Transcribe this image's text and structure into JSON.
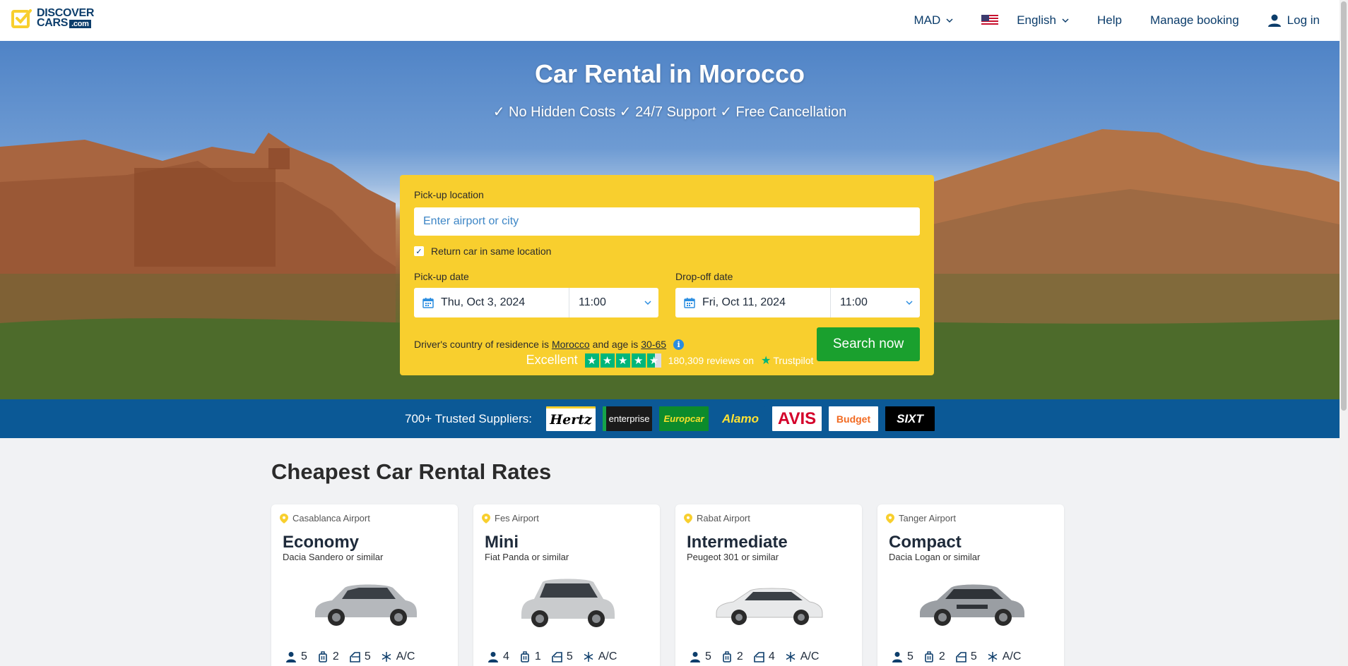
{
  "header": {
    "logo_line1": "DISCOVER",
    "logo_line2": "CARS",
    "logo_domain": ".com",
    "currency": "MAD",
    "language": "English",
    "help": "Help",
    "manage_booking": "Manage booking",
    "login": "Log in"
  },
  "hero": {
    "title": "Car Rental in Morocco",
    "subtitle": "✓ No Hidden Costs ✓ 24/7 Support ✓ Free Cancellation"
  },
  "search": {
    "pickup_location_label": "Pick-up location",
    "pickup_location_placeholder": "Enter airport or city",
    "return_same_label": "Return car in same location",
    "pickup_date_label": "Pick-up date",
    "pickup_date": "Thu, Oct 3, 2024",
    "pickup_time": "11:00",
    "dropoff_date_label": "Drop-off date",
    "dropoff_date": "Fri, Oct 11, 2024",
    "dropoff_time": "11:00",
    "residence_prefix": "Driver's country of residence is",
    "residence_country": "Morocco",
    "age_prefix": "and age is",
    "age_range": "30-65",
    "search_button": "Search now"
  },
  "trustpilot": {
    "rating_word": "Excellent",
    "reviews": "180,309 reviews on",
    "brand": "Trustpilot"
  },
  "suppliers": {
    "label": "700+ Trusted Suppliers:",
    "items": [
      {
        "name": "Hertz",
        "bg": "#ffffff",
        "fg": "#000000"
      },
      {
        "name": "enterprise",
        "bg": "#1a1a1a",
        "fg": "#ffffff"
      },
      {
        "name": "Europcar",
        "bg": "#0c8b2c",
        "fg": "#f5e12b"
      },
      {
        "name": "Alamo",
        "bg": "#0b5996",
        "fg": "#ffe233"
      },
      {
        "name": "AVIS",
        "bg": "#ffffff",
        "fg": "#d4002a"
      },
      {
        "name": "Budget",
        "bg": "#ffffff",
        "fg": "#f26a21"
      },
      {
        "name": "SIXT",
        "bg": "#000000",
        "fg": "#ffffff"
      }
    ]
  },
  "cheapest": {
    "title": "Cheapest Car Rental Rates",
    "cards": [
      {
        "location": "Casablanca Airport",
        "class": "Economy",
        "similar": "Dacia Sandero or similar",
        "seats": "5",
        "bags": "2",
        "doors": "5",
        "ac": "A/C"
      },
      {
        "location": "Fes Airport",
        "class": "Mini",
        "similar": "Fiat Panda or similar",
        "seats": "4",
        "bags": "1",
        "doors": "5",
        "ac": "A/C"
      },
      {
        "location": "Rabat Airport",
        "class": "Intermediate",
        "similar": "Peugeot 301 or similar",
        "seats": "5",
        "bags": "2",
        "doors": "4",
        "ac": "A/C"
      },
      {
        "location": "Tanger Airport",
        "class": "Compact",
        "similar": "Dacia Logan or similar",
        "seats": "5",
        "bags": "2",
        "doors": "5",
        "ac": "A/C"
      }
    ]
  },
  "colors": {
    "brand_blue": "#0c3d6b",
    "search_yellow": "#f8cf2e",
    "cta_green": "#1aa02e",
    "band_blue": "#0b5996"
  }
}
